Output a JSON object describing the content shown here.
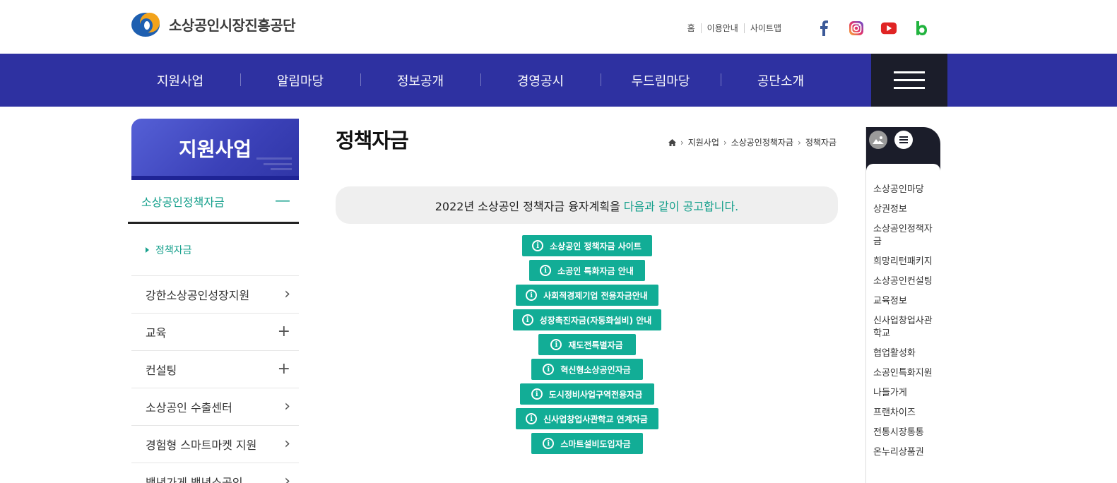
{
  "header": {
    "logo_text": "소상공인시장진흥공단",
    "util_links": [
      "홈",
      "이용안내",
      "사이트맵"
    ],
    "sns": [
      "facebook-icon",
      "instagram-icon",
      "youtube-icon",
      "blog-icon"
    ]
  },
  "gnb": {
    "items": [
      "지원사업",
      "알림마당",
      "정보공개",
      "경영공시",
      "두드림마당",
      "공단소개"
    ]
  },
  "snb": {
    "title": "지원사업",
    "active": "소상공인정책자금",
    "active_sub": "정책자금",
    "items": [
      {
        "label": "강한소상공인성장지원",
        "symbol": "›"
      },
      {
        "label": "교육",
        "symbol": "+"
      },
      {
        "label": "컨설팅",
        "symbol": "+"
      },
      {
        "label": "소상공인 수출센터",
        "symbol": "›"
      },
      {
        "label": "경험형 스마트마켓 지원",
        "symbol": "›"
      },
      {
        "label": "백년가게 백년소공인",
        "symbol": "›"
      }
    ]
  },
  "content": {
    "title": "정책자금",
    "breadcrumb": [
      "지원사업",
      "소상공인정책자금",
      "정책자금"
    ],
    "notice_text": "2022년 소상공인 정책자금 융자계획을",
    "notice_highlight": "다음과 같이 공고합니다.",
    "buttons": [
      "소상공인 정책자금 사이트",
      "소공인 특화자금 안내",
      "사회적경제기업 전용자금안내",
      "성장촉진자금(자동화설비) 안내",
      "재도전특별자금",
      "혁신형소상공인자금",
      "도시정비사업구역전용자금",
      "신사업창업사관학교 연계자금",
      "스마트설비도입자금"
    ]
  },
  "quick": {
    "items": [
      "소상공인마당",
      "상권정보",
      "소상공인정책자금",
      "희망리턴패키지",
      "소상공인컨설팅",
      "교육정보",
      "신사업창업사관학교",
      "협업활성화",
      "소공인특화지원",
      "나들가게",
      "프랜차이즈",
      "전통시장통통",
      "온누리상품권"
    ]
  },
  "colors": {
    "brand": "#2e31a1",
    "accent": "#12ad96",
    "dark": "#1b1d2a"
  }
}
